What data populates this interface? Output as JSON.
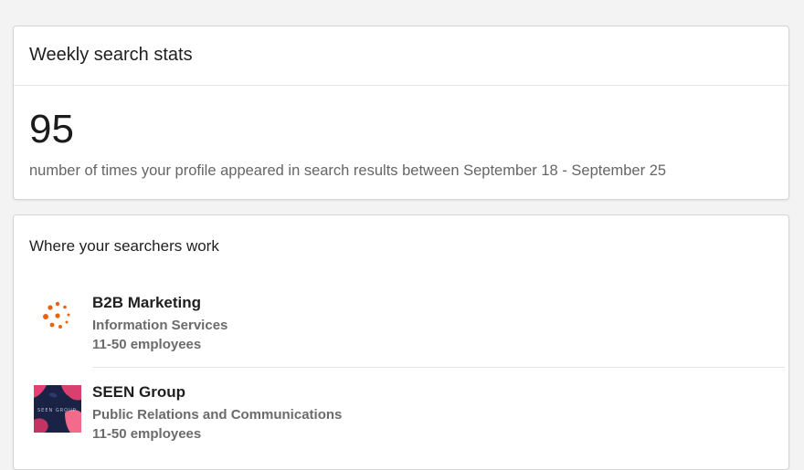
{
  "stats_card": {
    "title": "Weekly search stats",
    "count": "95",
    "description": "number of times your profile appeared in search results between September 18 - September 25"
  },
  "work_card": {
    "title": "Where your searchers work",
    "companies": [
      {
        "name": "B2B Marketing",
        "industry": "Information Services",
        "size": "11-50 employees",
        "logo_icon": "orange-dots-logo",
        "logo_color": "#e8620f"
      },
      {
        "name": "SEEN Group",
        "industry": "Public Relations and Communications",
        "size": "11-50 employees",
        "logo_icon": "seen-group-logo",
        "logo_text": "SEEN GROUP",
        "logo_color": "#1a2245"
      }
    ]
  }
}
